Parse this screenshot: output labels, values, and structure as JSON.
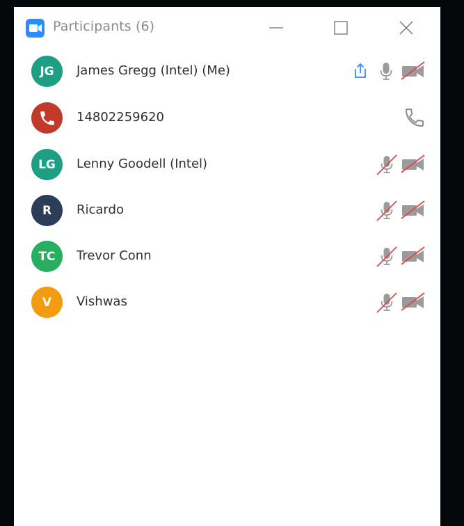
{
  "window": {
    "title": "Participants (6)"
  },
  "colors": {
    "brand_blue": "#2D8CFF",
    "muted_red": "#E0474C",
    "icon_gray": "#9b9b9b"
  },
  "participants": [
    {
      "initials": "JG",
      "name": "James Gregg (Intel) (Me)",
      "avatar_color": "#1E9E82",
      "icons": [
        "share-screen-icon",
        "microphone-icon",
        "video-off-icon"
      ]
    },
    {
      "initials": "",
      "name": "14802259620",
      "avatar_color": "#C0392B",
      "avatar_icon": "phone-icon",
      "icons": [
        "phone-icon"
      ]
    },
    {
      "initials": "LG",
      "name": "Lenny Goodell (Intel)",
      "avatar_color": "#1E9E82",
      "icons": [
        "microphone-muted-icon",
        "video-off-icon"
      ]
    },
    {
      "initials": "R",
      "name": "Ricardo",
      "avatar_color": "#2C3E57",
      "icons": [
        "microphone-muted-icon",
        "video-off-icon"
      ]
    },
    {
      "initials": "TC",
      "name": "Trevor Conn",
      "avatar_color": "#27AE60",
      "icons": [
        "microphone-muted-icon",
        "video-off-icon"
      ]
    },
    {
      "initials": "V",
      "name": "Vishwas",
      "avatar_color": "#F39C12",
      "icons": [
        "microphone-muted-icon",
        "video-off-icon"
      ]
    }
  ]
}
